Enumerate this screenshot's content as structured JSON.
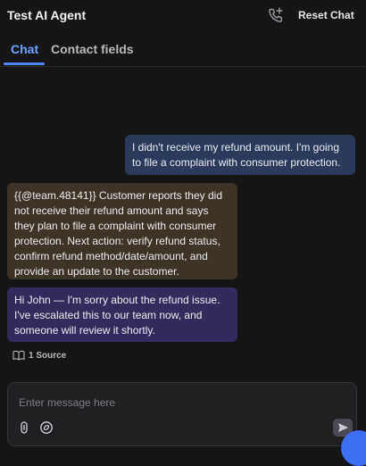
{
  "header": {
    "title": "Test AI Agent",
    "call_icon": "phone-plus-icon",
    "reset_label": "Reset Chat"
  },
  "tabs": [
    {
      "label": "Chat",
      "active": true
    },
    {
      "label": "Contact fields",
      "active": false
    }
  ],
  "messages": {
    "user": "I didn't receive my refund amount. I'm going to file a complaint with consumer protection.",
    "note": "{{@team.48141}} Customer reports they did not receive their refund amount and says they plan to file a complaint with consumer protection. Next action: verify refund status, confirm refund method/date/amount, and provide an update to the customer.",
    "agent": "Hi John — I'm sorry about the refund issue. I've escalated this to our team now, and someone will review it shortly."
  },
  "sources": {
    "label": "1 Source",
    "icon": "book-icon"
  },
  "composer": {
    "placeholder": "Enter message here",
    "value": "",
    "attach_icon": "attachment-icon",
    "ai_icon": "openai-icon",
    "send_icon": "send-icon"
  },
  "colors": {
    "background": "#151516",
    "accent": "#4f86f7",
    "user_bubble": "#2b3a5a",
    "note_bubble": "#3d3326",
    "agent_bubble": "#322c5e"
  }
}
